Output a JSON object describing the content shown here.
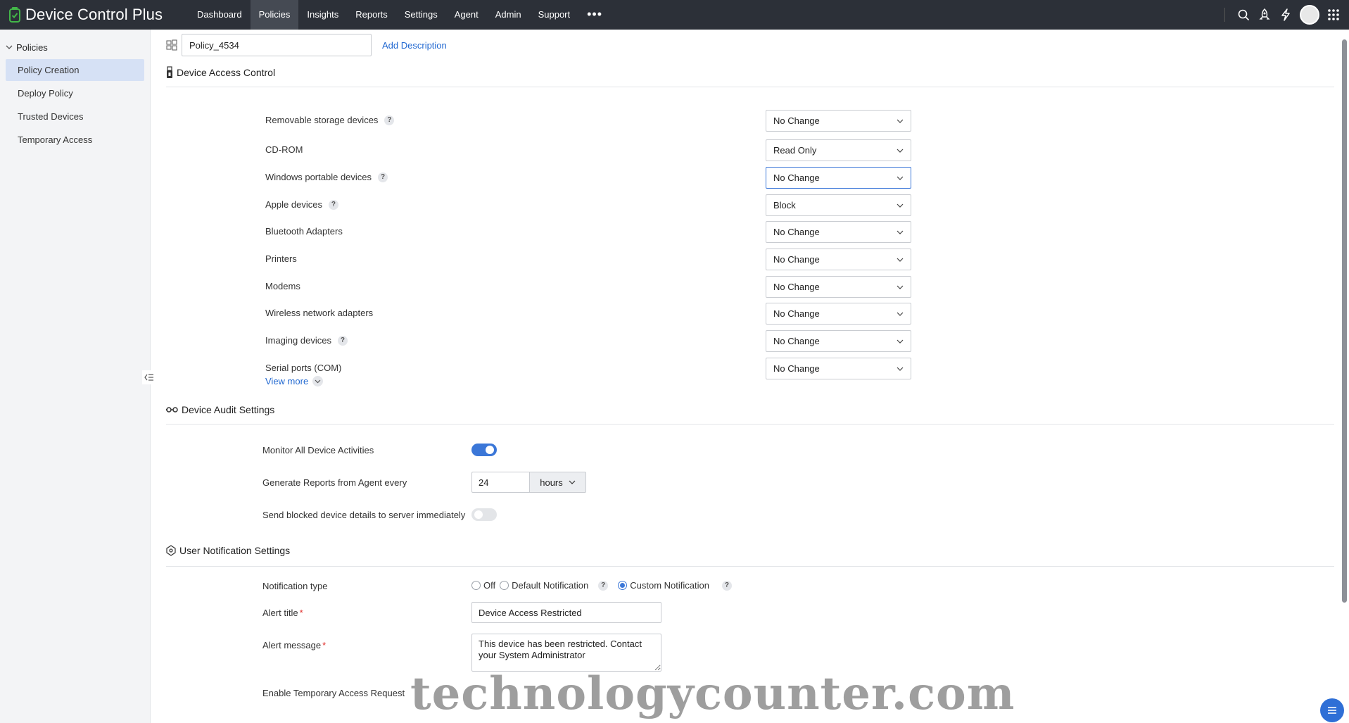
{
  "app": {
    "title": "Device Control Plus",
    "colors": {
      "topbar": "#2c3038",
      "accent": "#3b77d8",
      "link": "#2168d1",
      "required": "#e0312e"
    }
  },
  "nav": {
    "items": [
      "Dashboard",
      "Policies",
      "Insights",
      "Reports",
      "Settings",
      "Agent",
      "Admin",
      "Support"
    ],
    "active": "Policies",
    "more_label": "•••"
  },
  "topbar_icons": [
    "search-icon",
    "rocket-icon",
    "lightning-icon",
    "avatar",
    "app-grid-icon"
  ],
  "sidebar": {
    "group": "Policies",
    "items": [
      "Policy Creation",
      "Deploy Policy",
      "Trusted Devices",
      "Temporary Access"
    ],
    "active": "Policy Creation"
  },
  "policy": {
    "name": "Policy_4534",
    "add_description": "Add Description"
  },
  "device_access": {
    "title": "Device Access Control",
    "devices": [
      {
        "label": "Removable storage devices",
        "help": true,
        "value": "No Change"
      },
      {
        "label": "CD-ROM",
        "help": false,
        "value": "Read Only"
      },
      {
        "label": "Windows portable devices",
        "help": true,
        "value": "No Change"
      },
      {
        "label": "Apple devices",
        "help": true,
        "value": "Block"
      },
      {
        "label": "Bluetooth Adapters",
        "help": false,
        "value": "No Change"
      },
      {
        "label": "Printers",
        "help": false,
        "value": "No Change"
      },
      {
        "label": "Modems",
        "help": false,
        "value": "No Change"
      },
      {
        "label": "Wireless network adapters",
        "help": false,
        "value": "No Change"
      },
      {
        "label": "Imaging devices",
        "help": true,
        "value": "No Change"
      },
      {
        "label": "Serial ports (COM)",
        "help": false,
        "value": "No Change"
      }
    ],
    "view_more": "View more",
    "help_glyph": "?"
  },
  "audit": {
    "title": "Device Audit Settings",
    "monitor_label": "Monitor All Device Activities",
    "monitor_on": true,
    "report_label": "Generate Reports from Agent every",
    "report_value": "24",
    "report_unit": "hours",
    "send_blocked_label": "Send blocked device details to server immediately",
    "send_blocked_on": false
  },
  "notification": {
    "title": "User Notification Settings",
    "type_label": "Notification type",
    "options": [
      "Off",
      "Default Notification",
      "Custom Notification"
    ],
    "selected": "Custom Notification",
    "alert_title_label": "Alert title",
    "alert_title_value": "Device Access Restricted",
    "alert_message_label": "Alert message",
    "alert_message_value": "This device has been restricted. Contact your System Administrator",
    "required_mark": "*",
    "temp_access_label": "Enable Temporary Access Request"
  },
  "watermark": "technologycounter.com"
}
